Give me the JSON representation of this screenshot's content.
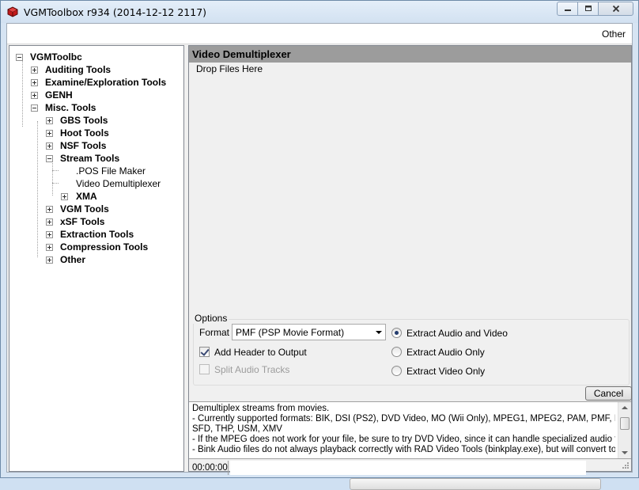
{
  "window": {
    "title": "VGMToolbox r934 (2014-12-12 2117)"
  },
  "menu": {
    "other_label": "Other"
  },
  "tree": {
    "root": "VGMToolbc",
    "items": [
      {
        "label": "Auditing Tools",
        "expanded": false
      },
      {
        "label": "Examine/Exploration Tools",
        "expanded": false
      },
      {
        "label": "GENH",
        "expanded": false
      },
      {
        "label": "Misc. Tools",
        "expanded": true
      },
      {
        "label": "GBS Tools",
        "expanded": false
      },
      {
        "label": "Hoot Tools",
        "expanded": false
      },
      {
        "label": "NSF Tools",
        "expanded": false
      },
      {
        "label": "Stream Tools",
        "expanded": true
      },
      {
        "label": ".POS File Maker"
      },
      {
        "label": "Video Demultiplexer"
      },
      {
        "label": "XMA",
        "expanded": false
      },
      {
        "label": "VGM Tools",
        "expanded": false
      },
      {
        "label": "xSF Tools",
        "expanded": false
      },
      {
        "label": "Extraction Tools",
        "expanded": false
      },
      {
        "label": "Compression Tools",
        "expanded": false
      },
      {
        "label": "Other",
        "expanded": false
      }
    ]
  },
  "panel": {
    "header": "Video Demultiplexer",
    "drop_label": "Drop Files Here",
    "options_legend": "Options",
    "format_label": "Format",
    "format_value": "PMF (PSP Movie Format)",
    "add_header_label": "Add Header to Output",
    "add_header_checked": true,
    "split_audio_label": "Split Audio Tracks",
    "split_audio_enabled": false,
    "radio_extract_both": "Extract Audio and Video",
    "radio_audio_only": "Extract Audio Only",
    "radio_video_only": "Extract Video Only",
    "selected_radio": "Extract Audio and Video",
    "cancel_label": "Cancel"
  },
  "description": {
    "lines": [
      "Demultiplex streams from movies.",
      "- Currently supported formats: BIK, DSI (PS2), DVD Video, MO (Wii Only), MPEG1, MPEG2, PAM, PMF, PSS,",
      "SFD, THP, USM, XMV",
      "- If the MPEG does not work for your file, be sure to try DVD Video, since it can handle specialized audio types.",
      "- Bink Audio files do not always playback correctly with RAD Video Tools (binkplay.exe), but will convert to WAV"
    ]
  },
  "status": {
    "elapsed": "00:00:00",
    "progress_percent": 0
  },
  "colors": {
    "header_bg": "#9c9c9c",
    "window_bg": "#d6e4f3",
    "progress_fill": "#33c241"
  }
}
